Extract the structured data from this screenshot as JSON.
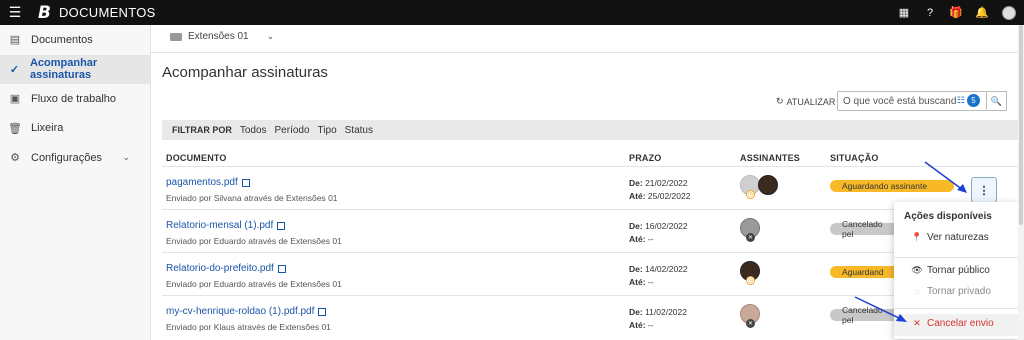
{
  "topbar": {
    "brand": "B",
    "title": "DOCUMENTOS",
    "icons": [
      "menu-icon",
      "apps-icon",
      "help-icon",
      "gift-icon",
      "bell-icon",
      "avatar"
    ]
  },
  "sidebar": {
    "items": [
      {
        "label": "Documentos",
        "icon": "document-icon",
        "active": false
      },
      {
        "label": "Acompanhar assinaturas",
        "icon": "signature-icon",
        "active": true
      },
      {
        "label": "Fluxo de trabalho",
        "icon": "briefcase-icon",
        "active": false
      },
      {
        "label": "Lixeira",
        "icon": "trash-icon",
        "active": false
      },
      {
        "label": "Configurações",
        "icon": "gear-icon",
        "active": false
      }
    ]
  },
  "workspace": {
    "label": "Extensões 01"
  },
  "page": {
    "title": "Acompanhar assinaturas",
    "refresh_label": "ATUALIZAR",
    "search_placeholder": "O que você está buscand",
    "filter_count": "5"
  },
  "filters": {
    "label": "FILTRAR POR",
    "options": [
      "Todos",
      "Período",
      "Tipo",
      "Status"
    ]
  },
  "columns": {
    "documento": "DOCUMENTO",
    "prazo": "PRAZO",
    "assinantes": "ASSINANTES",
    "situacao": "SITUAÇÃO"
  },
  "rows": [
    {
      "name": "pagamentos.pdf",
      "sent_by": "Enviado por Silvana  através de Extensões 01",
      "de_label": "De:",
      "de": "21/02/2022",
      "ate_label": "Até:",
      "ate": "25/02/2022",
      "status": "Aguardando assinante"
    },
    {
      "name": "Relatorio-mensal (1).pdf",
      "sent_by": "Enviado por Eduardo  através de Extensões 01",
      "de_label": "De:",
      "de": "16/02/2022",
      "ate_label": "Até:",
      "ate": "--",
      "status": "Cancelado pel"
    },
    {
      "name": "Relatorio-do-prefeito.pdf",
      "sent_by": "Enviado por Eduardo  através de Extensões 01",
      "de_label": "De:",
      "de": "14/02/2022",
      "ate_label": "Até:",
      "ate": "--",
      "status": "Aguardand"
    },
    {
      "name": "my-cv-henrique-roldao (1).pdf.pdf",
      "sent_by": "Enviado por Klaus  através de Extensões 01",
      "de_label": "De:",
      "de": "11/02/2022",
      "ate_label": "Até:",
      "ate": "--",
      "status": "Cancelado pel"
    }
  ],
  "menu": {
    "heading": "Ações disponíveis",
    "items": [
      "Ver naturezas",
      "Tornar público",
      "Tornar privado",
      "Cancelar envio"
    ]
  },
  "colors": {
    "accent": "#1a56a8",
    "waiting": "#f7b928",
    "cancelled": "#c8c8c8",
    "danger": "#d9342b",
    "arrow": "#1f3fd6"
  }
}
